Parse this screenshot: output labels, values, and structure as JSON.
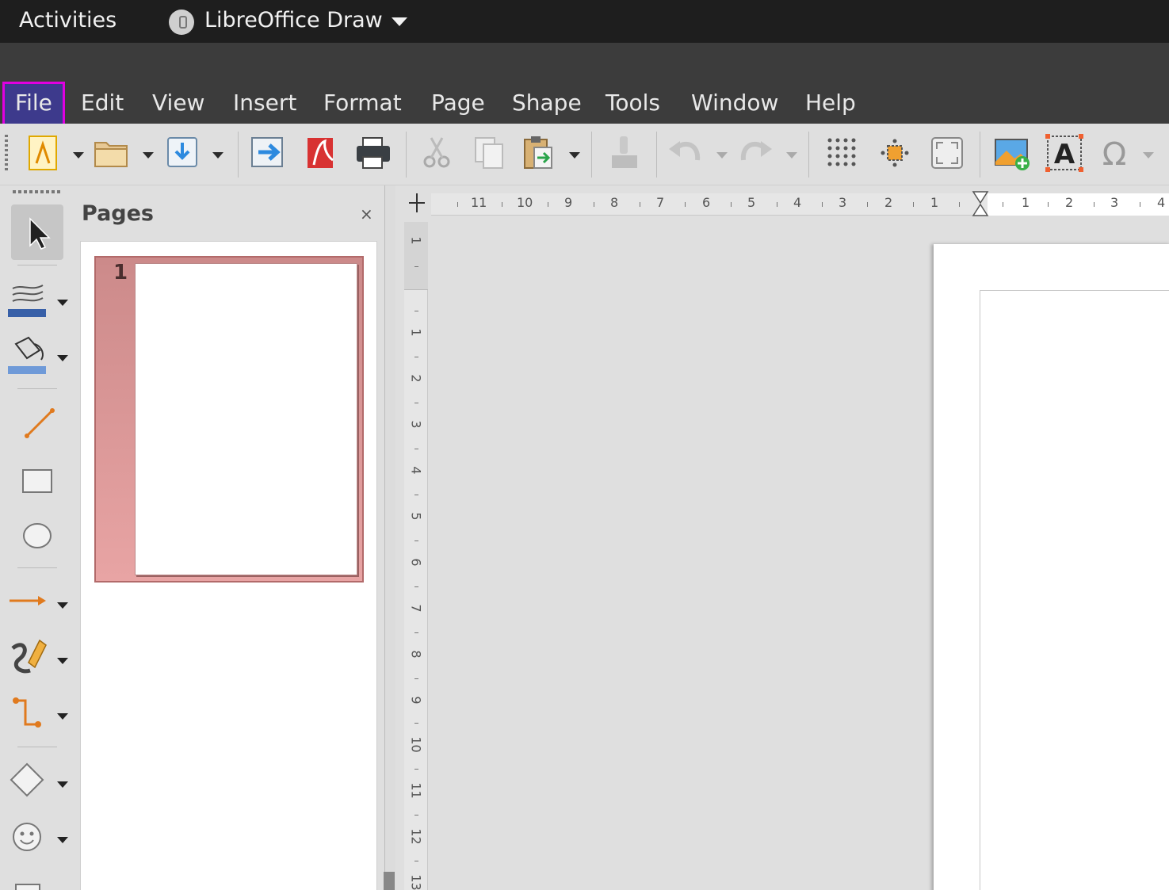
{
  "topbar": {
    "activities": "Activities",
    "app_name": "LibreOffice Draw"
  },
  "menubar": {
    "items": [
      "File",
      "Edit",
      "View",
      "Insert",
      "Format",
      "Page",
      "Shape",
      "Tools",
      "Window",
      "Help"
    ],
    "active": "File"
  },
  "toolbar": {
    "icons": [
      "new-document-icon",
      "open-folder-icon",
      "save-icon",
      "export-icon",
      "export-pdf-icon",
      "print-icon",
      "cut-icon",
      "copy-icon",
      "paste-icon",
      "clone-formatting-icon",
      "undo-icon",
      "redo-icon",
      "grid-icon",
      "helplines-icon",
      "zoom-pan-icon",
      "insert-image-icon",
      "insert-text-box-icon",
      "special-character-icon"
    ]
  },
  "left_toolbar": {
    "icons": [
      "select-arrow-icon",
      "line-color-icon",
      "fill-color-icon",
      "line-icon",
      "rectangle-icon",
      "ellipse-icon",
      "arrow-line-icon",
      "curve-icon",
      "connector-icon",
      "basic-shapes-icon",
      "symbol-shapes-icon"
    ]
  },
  "pages_pane": {
    "title": "Pages",
    "close": "×",
    "pages": [
      {
        "number": "1"
      }
    ]
  },
  "rulers": {
    "horizontal": [
      "11",
      "10",
      "9",
      "8",
      "7",
      "6",
      "5",
      "4",
      "3",
      "2",
      "1",
      "1",
      "2",
      "3",
      "4"
    ],
    "vertical": [
      "1",
      "1",
      "2",
      "3",
      "4",
      "5",
      "6",
      "7",
      "8",
      "9",
      "10",
      "11",
      "12",
      "13"
    ]
  }
}
